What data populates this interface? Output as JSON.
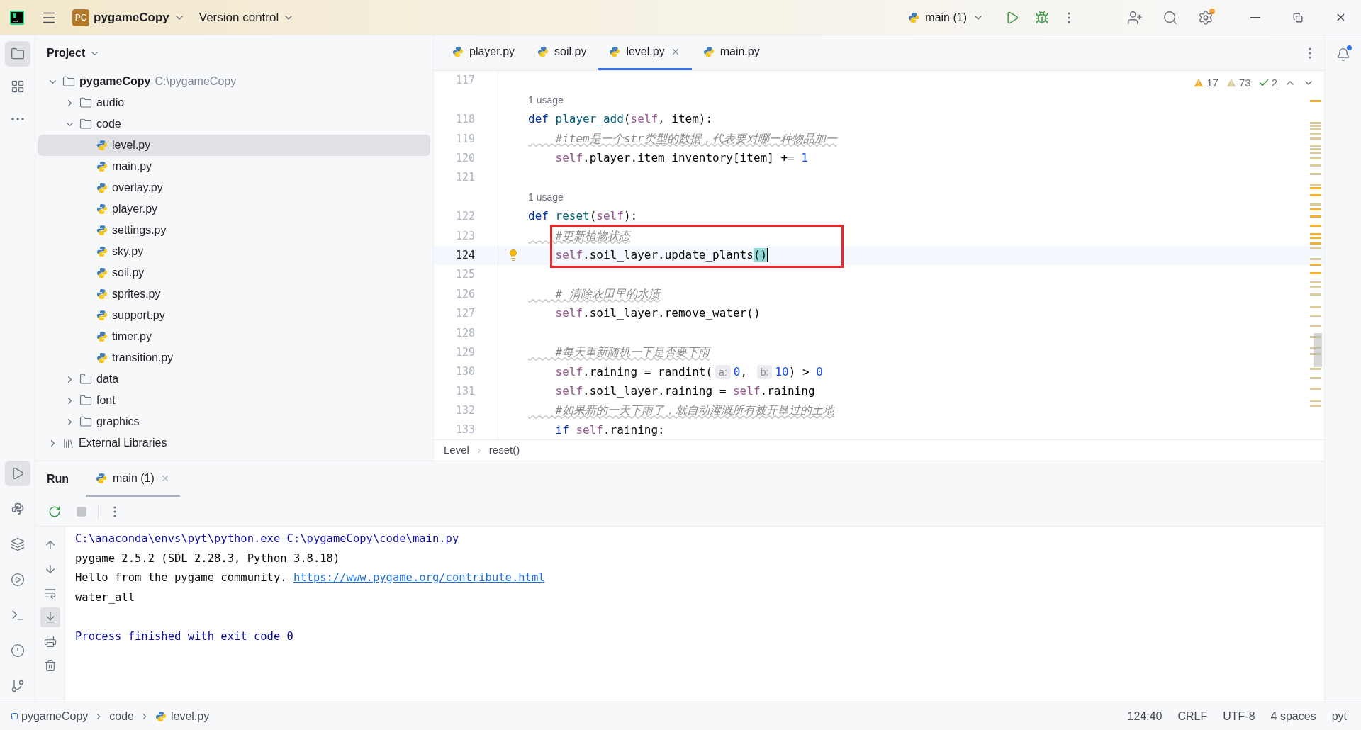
{
  "title_bar": {
    "badge": "PC",
    "project": "pygameCopy",
    "vcs": "Version control",
    "run_config": "main (1)"
  },
  "tool_strip_top": [
    {
      "kind": "project",
      "selected": true
    },
    {
      "kind": "structure",
      "selected": false
    },
    {
      "kind": "more",
      "selected": false
    }
  ],
  "tool_strip_bottom": [
    {
      "kind": "run",
      "selected": true
    },
    {
      "kind": "python",
      "selected": false
    },
    {
      "kind": "layers",
      "selected": false
    },
    {
      "kind": "services",
      "selected": false
    },
    {
      "kind": "terminal",
      "selected": false
    },
    {
      "kind": "problems",
      "selected": false
    },
    {
      "kind": "git",
      "selected": false
    }
  ],
  "project_panel": {
    "title": "Project",
    "tree": [
      {
        "name": "pygameCopy",
        "path": "C:\\pygameCopy",
        "kind": "root",
        "expanded": true,
        "selected": false,
        "children": [
          {
            "name": "audio",
            "kind": "folder",
            "expanded": false,
            "selected": false
          },
          {
            "name": "code",
            "kind": "folder",
            "expanded": true,
            "selected": false,
            "children": [
              {
                "name": "level.py",
                "kind": "python",
                "selected": true
              },
              {
                "name": "main.py",
                "kind": "python",
                "selected": false
              },
              {
                "name": "overlay.py",
                "kind": "python",
                "selected": false
              },
              {
                "name": "player.py",
                "kind": "python",
                "selected": false
              },
              {
                "name": "settings.py",
                "kind": "python",
                "selected": false
              },
              {
                "name": "sky.py",
                "kind": "python",
                "selected": false
              },
              {
                "name": "soil.py",
                "kind": "python",
                "selected": false
              },
              {
                "name": "sprites.py",
                "kind": "python",
                "selected": false
              },
              {
                "name": "support.py",
                "kind": "python",
                "selected": false
              },
              {
                "name": "timer.py",
                "kind": "python",
                "selected": false
              },
              {
                "name": "transition.py",
                "kind": "python",
                "selected": false
              }
            ]
          },
          {
            "name": "data",
            "kind": "folder",
            "expanded": false,
            "selected": false
          },
          {
            "name": "font",
            "kind": "folder",
            "expanded": false,
            "selected": false
          },
          {
            "name": "graphics",
            "kind": "folder",
            "expanded": false,
            "selected": false
          }
        ]
      },
      {
        "name": "External Libraries",
        "kind": "library",
        "expanded": false,
        "selected": false
      }
    ]
  },
  "editor": {
    "tabs": [
      {
        "label": "player.py",
        "selected": false
      },
      {
        "label": "soil.py",
        "selected": false
      },
      {
        "label": "level.py",
        "selected": true
      },
      {
        "label": "main.py",
        "selected": false
      }
    ],
    "inspections": [
      {
        "kind": "warning",
        "count": "17"
      },
      {
        "kind": "weak_warning",
        "count": "73"
      },
      {
        "kind": "typo",
        "count": "2"
      }
    ],
    "lines": [
      {
        "kind": "code",
        "number": "117",
        "current": false,
        "boxed": false,
        "bulb": false
      },
      {
        "kind": "usage",
        "text": "1 usage"
      },
      {
        "kind": "code",
        "number": "118",
        "current": false,
        "boxed": false,
        "bulb": false,
        "tokens": [
          {
            "text": "def ",
            "kind": "keyword"
          },
          {
            "text": "player_add",
            "kind": "function"
          },
          {
            "text": "(",
            "kind": "plain"
          },
          {
            "text": "self",
            "kind": "self"
          },
          {
            "text": ", item):",
            "kind": "plain"
          }
        ]
      },
      {
        "kind": "code",
        "number": "119",
        "current": false,
        "boxed": false,
        "bulb": false,
        "tokens": [
          {
            "text": "    #item是一个str类型的数据，代表要对哪一种物品加一",
            "kind": "comment"
          }
        ]
      },
      {
        "kind": "code",
        "number": "120",
        "current": false,
        "boxed": false,
        "bulb": false,
        "tokens": [
          {
            "text": "    self",
            "kind": "self"
          },
          {
            "text": ".player.item_inventory[item] += ",
            "kind": "plain"
          },
          {
            "text": "1",
            "kind": "number"
          }
        ]
      },
      {
        "kind": "code",
        "number": "121",
        "current": false,
        "boxed": false,
        "bulb": false
      },
      {
        "kind": "usage",
        "text": "1 usage"
      },
      {
        "kind": "code",
        "number": "122",
        "current": false,
        "boxed": false,
        "bulb": false,
        "tokens": [
          {
            "text": "def ",
            "kind": "keyword"
          },
          {
            "text": "reset",
            "kind": "function"
          },
          {
            "text": "(",
            "kind": "plain"
          },
          {
            "text": "self",
            "kind": "self"
          },
          {
            "text": "):",
            "kind": "plain"
          }
        ]
      },
      {
        "kind": "code",
        "number": "123",
        "current": false,
        "boxed": true,
        "bulb": false,
        "tokens": [
          {
            "text": "    #更新植物状态",
            "kind": "comment"
          }
        ]
      },
      {
        "kind": "code",
        "number": "124",
        "current": true,
        "boxed": true,
        "bulb": true,
        "tokens": [
          {
            "text": "    self",
            "kind": "self"
          },
          {
            "text": ".soil_layer.update_plants",
            "kind": "plain"
          },
          {
            "text": "()",
            "kind": "match"
          }
        ]
      },
      {
        "kind": "code",
        "number": "125",
        "current": false,
        "boxed": false,
        "bulb": false
      },
      {
        "kind": "code",
        "number": "126",
        "current": false,
        "boxed": false,
        "bulb": false,
        "tokens": [
          {
            "text": "    # 清除农田里的水渍",
            "kind": "comment"
          }
        ]
      },
      {
        "kind": "code",
        "number": "127",
        "current": false,
        "boxed": false,
        "bulb": false,
        "tokens": [
          {
            "text": "    self",
            "kind": "self"
          },
          {
            "text": ".soil_layer.remove_water()",
            "kind": "plain"
          }
        ]
      },
      {
        "kind": "code",
        "number": "128",
        "current": false,
        "boxed": false,
        "bulb": false
      },
      {
        "kind": "code",
        "number": "129",
        "current": false,
        "boxed": false,
        "bulb": false,
        "tokens": [
          {
            "text": "    #每天重新随机一下是否要下雨",
            "kind": "comment"
          }
        ]
      },
      {
        "kind": "code",
        "number": "130",
        "current": false,
        "boxed": false,
        "bulb": false,
        "tokens": [
          {
            "text": "    self",
            "kind": "self"
          },
          {
            "text": ".raining = randint(",
            "kind": "plain"
          },
          {
            "text": "a:",
            "kind": "hint"
          },
          {
            "text": "0",
            "kind": "number"
          },
          {
            "text": ", ",
            "kind": "plain"
          },
          {
            "text": "b:",
            "kind": "hint"
          },
          {
            "text": "10",
            "kind": "number"
          },
          {
            "text": ") > ",
            "kind": "plain"
          },
          {
            "text": "0",
            "kind": "number"
          }
        ]
      },
      {
        "kind": "code",
        "number": "131",
        "current": false,
        "boxed": false,
        "bulb": false,
        "tokens": [
          {
            "text": "    self",
            "kind": "self"
          },
          {
            "text": ".soil_layer.raining = ",
            "kind": "plain"
          },
          {
            "text": "self",
            "kind": "self"
          },
          {
            "text": ".raining",
            "kind": "plain"
          }
        ]
      },
      {
        "kind": "code",
        "number": "132",
        "current": false,
        "boxed": false,
        "bulb": false,
        "tokens": [
          {
            "text": "    #如果新的一天下雨了，就自动灌溉所有被开垦过的土地",
            "kind": "comment"
          }
        ]
      },
      {
        "kind": "code",
        "number": "133",
        "current": false,
        "boxed": false,
        "bulb": false,
        "tokens": [
          {
            "text": "    if ",
            "kind": "keyword"
          },
          {
            "text": "self",
            "kind": "self"
          },
          {
            "text": ".raining:",
            "kind": "plain"
          }
        ]
      }
    ],
    "breadcrumbs": [
      "Level",
      "reset()"
    ]
  },
  "run_panel": {
    "title": "Run",
    "tabs": [
      {
        "label": "main (1)",
        "selected": true
      }
    ],
    "side_tools": [
      {
        "kind": "up",
        "selected": false
      },
      {
        "kind": "down",
        "selected": false
      },
      {
        "kind": "wrap",
        "selected": false
      },
      {
        "kind": "scroll_end",
        "selected": true
      },
      {
        "kind": "print",
        "selected": false
      },
      {
        "kind": "trash",
        "selected": false
      }
    ],
    "console": [
      {
        "kind": "command",
        "text": "C:\\anaconda\\envs\\pyt\\python.exe C:\\pygameCopy\\code\\main.py"
      },
      {
        "kind": "output",
        "text": "pygame 2.5.2 (SDL 2.28.3, Python 3.8.18)"
      },
      {
        "kind": "output",
        "text": "Hello from the pygame community. ",
        "link": "https://www.pygame.org/contribute.html"
      },
      {
        "kind": "output",
        "text": "water_all"
      },
      {
        "kind": "exit",
        "text": "Process finished with exit code 0"
      }
    ]
  },
  "status_bar": {
    "path": [
      "pygameCopy",
      "code",
      "level.py"
    ],
    "items": [
      "124:40",
      "CRLF",
      "UTF-8",
      "4 spaces",
      "pyt"
    ]
  }
}
